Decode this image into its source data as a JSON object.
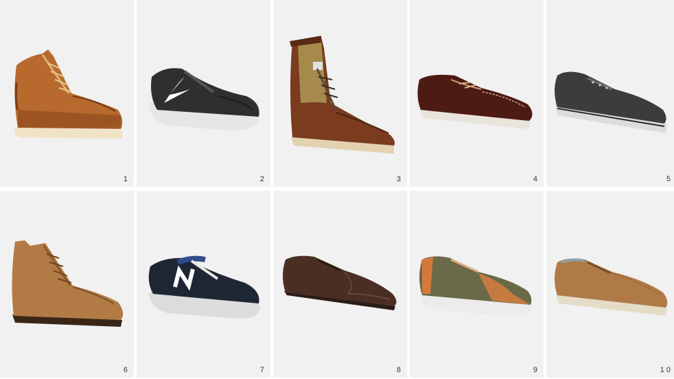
{
  "tiles": [
    {
      "number": "1",
      "shoe": "tan leather moc-toe work boot with cream wedge sole"
    },
    {
      "number": "2",
      "shoe": "dark grey mesh running sneaker with white swoosh"
    },
    {
      "number": "3",
      "shoe": "brown leather and olive canvas tall boot"
    },
    {
      "number": "4",
      "shoe": "dark brown boat shoe with white sole"
    },
    {
      "number": "5",
      "shoe": "charcoal canvas laceless low-top sneaker"
    },
    {
      "number": "6",
      "shoe": "tan suede moc-toe chukka boot"
    },
    {
      "number": "7",
      "shoe": "navy suede running sneaker with white N logo"
    },
    {
      "number": "8",
      "shoe": "dark brown suede wingtip oxford"
    },
    {
      "number": "9",
      "shoe": "olive and tan canvas low-top sneaker"
    },
    {
      "number": "10",
      "shoe": "tan perforated suede derby shoe"
    }
  ],
  "colors": {
    "tile_background": "#f1f1f1",
    "gutter": "#ffffff",
    "label": "#333333"
  }
}
